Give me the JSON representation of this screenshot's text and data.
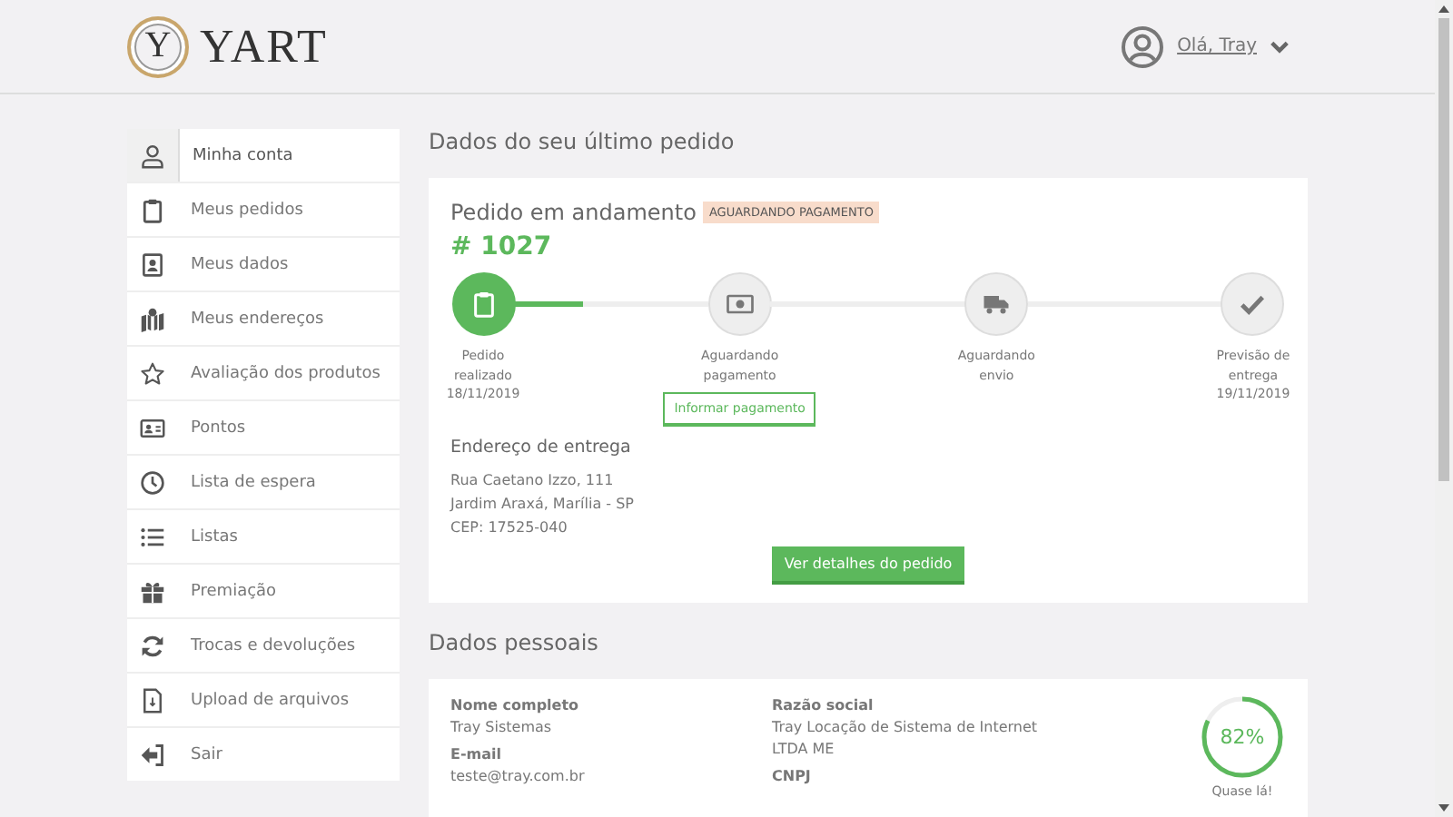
{
  "header": {
    "logo_letter": "Y",
    "logo_text": "YART",
    "user_greeting": "Olá, Tray"
  },
  "sidebar": {
    "items": [
      {
        "label": "Minha conta",
        "selected": true
      },
      {
        "label": "Meus pedidos",
        "selected": false
      },
      {
        "label": "Meus dados",
        "selected": false
      },
      {
        "label": "Meus endereços",
        "selected": false
      },
      {
        "label": "Avaliação dos produtos",
        "selected": false
      },
      {
        "label": "Pontos",
        "selected": false
      },
      {
        "label": "Lista de espera",
        "selected": false
      },
      {
        "label": "Listas",
        "selected": false
      },
      {
        "label": "Premiação",
        "selected": false
      },
      {
        "label": "Trocas e devoluções",
        "selected": false
      },
      {
        "label": "Upload de arquivos",
        "selected": false
      },
      {
        "label": "Sair",
        "selected": false
      }
    ]
  },
  "last_order": {
    "section_title": "Dados do seu último pedido",
    "status_title": "Pedido em andamento",
    "status_badge": "AGUARDANDO PAGAMENTO",
    "order_number": "# 1027",
    "progress": {
      "level": 0.35
    },
    "steps": [
      {
        "lines": [
          "Pedido",
          "realizado",
          "18/11/2019"
        ],
        "done": true
      },
      {
        "lines": [
          "Aguardando",
          "pagamento"
        ],
        "done": false,
        "action": "Informar pagamento"
      },
      {
        "lines": [
          "Aguardando",
          "envio"
        ],
        "done": false
      },
      {
        "lines": [
          "Previsão de",
          "entrega",
          "19/11/2019"
        ],
        "done": false
      }
    ],
    "address_title": "Endereço de entrega",
    "address_lines": [
      "Rua Caetano Izzo, 111",
      "Jardim Araxá, Marília - SP",
      "CEP: 17525-040"
    ],
    "details_button": "Ver detalhes do pedido"
  },
  "personal": {
    "section_title": "Dados pessoais",
    "columns": [
      [
        {
          "label": "Nome completo",
          "value": "Tray Sistemas"
        },
        {
          "label": "E-mail",
          "value": "teste@tray.com.br"
        }
      ],
      [
        {
          "label": "Razão social",
          "value": "Tray Locação de Sistema de Internet LTDA ME"
        },
        {
          "label": "CNPJ"
        }
      ]
    ],
    "completion": {
      "level": 0.82,
      "reading": "82%",
      "caption": "Quase lá!"
    }
  }
}
